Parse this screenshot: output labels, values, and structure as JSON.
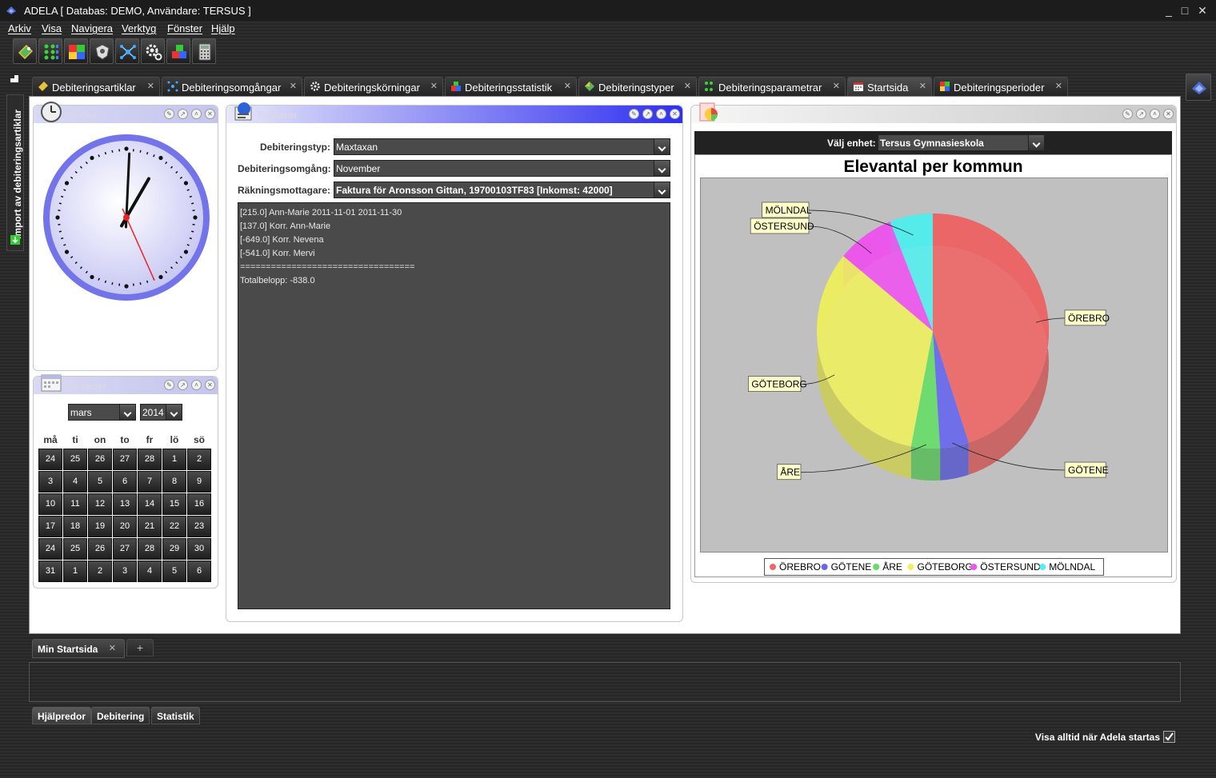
{
  "window": {
    "title": "ADELA [ Databas: DEMO, Användare: TERSUS ]",
    "controls": [
      "_",
      "□",
      "✕"
    ]
  },
  "menu": [
    "Arkiv",
    "Visa",
    "Navigera",
    "Verktyg",
    "Fönster",
    "Hjälp"
  ],
  "toolbar": {
    "buttons": [
      "debiteringsartiklar-icon",
      "debiteringsparametrar-icon",
      "debiteringsperioder-icon",
      "badge-icon",
      "network-icon",
      "gear-icon",
      "blocks-icon",
      "calculator-icon"
    ]
  },
  "side_panel": {
    "label": "Import av debiteringsartiklar"
  },
  "tabs": [
    {
      "label": "Debiteringsartiklar",
      "active": false
    },
    {
      "label": "Debiteringsomgångar",
      "active": false
    },
    {
      "label": "Debiteringskörningar",
      "active": false
    },
    {
      "label": "Debiteringsstatistik",
      "active": false
    },
    {
      "label": "Debiteringstyper",
      "active": false
    },
    {
      "label": "Debiteringsparametrar",
      "active": false
    },
    {
      "label": "Startsida",
      "active": true
    },
    {
      "label": "Debiteringsperioder",
      "active": false
    }
  ],
  "portlets": {
    "clock": {
      "title": "Klocka",
      "time": {
        "hour": 1,
        "minute": 0,
        "second": 26
      }
    },
    "calendar": {
      "title": "Kalender",
      "month": "mars",
      "year": "2014",
      "weekdays": [
        "må",
        "ti",
        "on",
        "to",
        "fr",
        "lö",
        "sö"
      ],
      "weeks": [
        [
          "24",
          "25",
          "26",
          "27",
          "28",
          "1",
          "2"
        ],
        [
          "3",
          "4",
          "5",
          "6",
          "7",
          "8",
          "9"
        ],
        [
          "10",
          "11",
          "12",
          "13",
          "14",
          "15",
          "16"
        ],
        [
          "17",
          "18",
          "19",
          "20",
          "21",
          "22",
          "23"
        ],
        [
          "24",
          "25",
          "26",
          "27",
          "28",
          "29",
          "30"
        ],
        [
          "31",
          "1",
          "2",
          "3",
          "4",
          "5",
          "6"
        ]
      ]
    },
    "invoices": {
      "title": "Fakturor",
      "fields": [
        {
          "label": "Debiteringstyp:",
          "value": "Maxtaxan"
        },
        {
          "label": "Debiteringsomgång:",
          "value": "November"
        },
        {
          "label": "Räkningsmottagare:",
          "value": "Faktura för Aronsson Gittan, 19700103TF83 [Inkomst: 42000]"
        }
      ],
      "lines": [
        "[215.0] Ann-Marie 2011-11-01 2011-11-30",
        "[137.0] Korr. Ann-Marie",
        "[-649.0] Korr. Nevena",
        "[-541.0] Korr. Mervi",
        "==================================",
        "Totalbelopp: -838.0"
      ]
    },
    "chart": {
      "unit_label": "Välj enhet:",
      "unit_value": "Tersus Gymnasieskola"
    }
  },
  "chart_data": {
    "type": "pie",
    "title": "Elevantal per kommun",
    "series": [
      {
        "name": "ÖREBRO",
        "value": 45,
        "color": "#ee6666"
      },
      {
        "name": "GÖTENE",
        "value": 4,
        "color": "#6666ee"
      },
      {
        "name": "ÅRE",
        "value": 4,
        "color": "#66dd66"
      },
      {
        "name": "GÖTEBORG",
        "value": 33,
        "color": "#f0f060"
      },
      {
        "name": "ÖSTERSUND",
        "value": 8,
        "color": "#ee55ee"
      },
      {
        "name": "MÖLNDAL",
        "value": 6,
        "color": "#55eeee"
      }
    ],
    "legend_position": "bottom"
  },
  "bottom": {
    "tab_label": "Min Startsida",
    "add_label": "+",
    "tabs": [
      {
        "label": "Hjälpredor",
        "active": true
      },
      {
        "label": "Debitering",
        "active": false
      },
      {
        "label": "Statistik",
        "active": false
      }
    ],
    "startup_label": "Visa alltid när Adela startas",
    "startup_checked": true
  }
}
